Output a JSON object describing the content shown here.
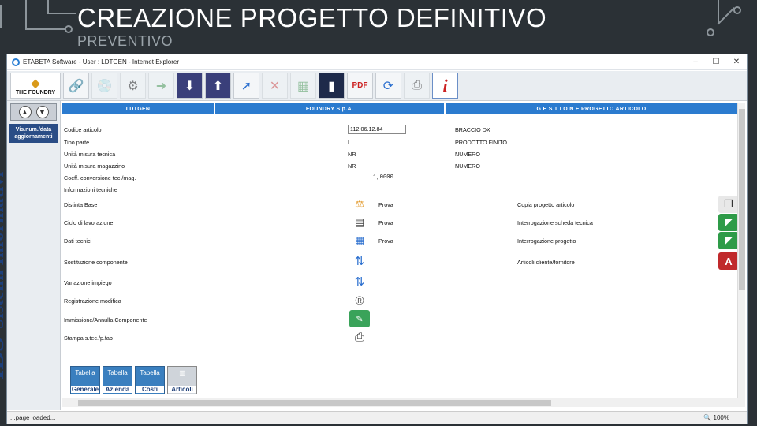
{
  "slide": {
    "title": "CREAZIONE PROGETTO DEFINITIVO",
    "subtitle": "PREVENTIVO"
  },
  "window": {
    "title": "ETABETA Software - User : LDTGEN - Internet Explorer",
    "minimize": "–",
    "maximize": "☐",
    "close": "✕"
  },
  "toolbar": {
    "logo_text": "THE FOUNDRY",
    "icons": [
      "logo-icon",
      "link-icon",
      "disc-icon",
      "disc-dim-icon",
      "exit-icon",
      "book-down-icon",
      "book-up-icon",
      "search-arrow-icon",
      "delete-icon",
      "excel-icon",
      "door-icon",
      "pdf-icon",
      "refresh-icon",
      "print-icon",
      "info-icon"
    ]
  },
  "leftpanel": {
    "vis_button": "Vis.num./data aggiornamenti",
    "brand_ibs": "IBS",
    "brand_text": "Sistemi Informativi"
  },
  "header": {
    "col1": "LDTGEN",
    "col2": "FOUNDRY S.p.A.",
    "col3": "G E S T I O N E   PROGETTO ARTICOLO"
  },
  "fields": {
    "codice_label": "Codice articolo",
    "codice_value": "112.06.12.84",
    "codice_desc": "BRACCIO DX",
    "tipo_label": "Tipo parte",
    "tipo_value": "L",
    "tipo_desc": "PRODOTTO FINITO",
    "umt_label": "Unità misura tecnica",
    "umt_value": "NR",
    "umt_desc": "NUMERO",
    "umm_label": "Unità misura magazzino",
    "umm_value": "NR",
    "umm_desc": "NUMERO",
    "coeff_label": "Coeff. conversione tec./mag.",
    "coeff_value": "1,0000",
    "info_label": "Informazioni tecniche"
  },
  "actions": {
    "distinta": "Distinta Base",
    "ciclo": "Ciclo di lavorazione",
    "dati": "Dati tecnici",
    "prova": "Prova",
    "sostituzione": "Sostituzione componente",
    "variazione": "Variazione impiego",
    "registrazione": "Registrazione modifica",
    "immissione": "Immissione/Annulla Componente",
    "stampa": "Stampa s.tec./p.fab",
    "copia": "Copia progetto articolo",
    "interr_scheda": "Interrogazione scheda tecnica",
    "interr_progetto": "Interrogazione progetto",
    "articoli_cliente": "Articoli cliente/fornitore"
  },
  "tiles": [
    {
      "top": "Tabella",
      "bottom": "Generale"
    },
    {
      "top": "Tabella",
      "bottom": "Azienda"
    },
    {
      "top": "Tabella",
      "bottom": "Costi"
    },
    {
      "top": "",
      "bottom": "Articoli"
    }
  ],
  "status": {
    "text": "...page loaded...",
    "zoom": "🔍 100%"
  }
}
